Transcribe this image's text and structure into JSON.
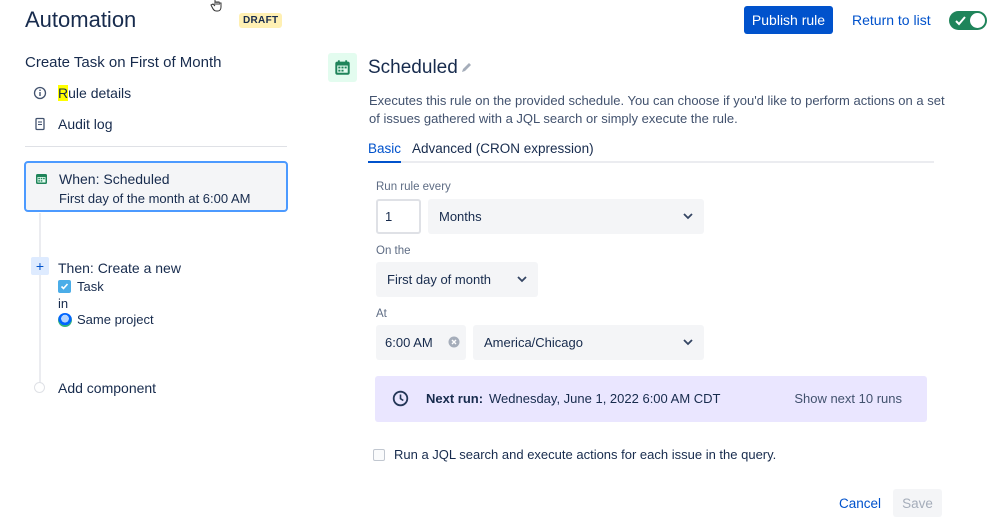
{
  "header": {
    "title": "Automation",
    "badge": "DRAFT",
    "publish_label": "Publish rule",
    "return_label": "Return to list",
    "enabled": true
  },
  "sidebar": {
    "rule_name": "Create Task on First of Month",
    "links": [
      {
        "label_highlight": "R",
        "label_rest": "ule details",
        "icon": "info-icon"
      },
      {
        "label": "Audit log",
        "icon": "document-icon"
      }
    ],
    "trigger": {
      "title": "When: Scheduled",
      "subtitle": "First day of the month at 6:00 AM",
      "icon": "calendar-icon"
    },
    "action": {
      "title": "Then: Create a new",
      "issue_type": "Task",
      "connector": "in",
      "project": "Same project"
    },
    "add_component": "Add component"
  },
  "main": {
    "title": "Scheduled",
    "description": "Executes this rule on the provided schedule. You can choose if you'd like to perform actions on a set of issues gathered with a JQL search or simply execute the rule.",
    "tabs": [
      {
        "label": "Basic",
        "active": true
      },
      {
        "label": "Advanced (CRON expression)",
        "active": false
      }
    ],
    "run_every": {
      "label": "Run rule every",
      "value": "1",
      "unit": "Months"
    },
    "on_the": {
      "label": "On the",
      "value": "First day of month"
    },
    "at": {
      "label": "At",
      "time": "6:00 AM",
      "timezone": "America/Chicago"
    },
    "next_run": {
      "label": "Next run:",
      "value": "Wednesday, June 1, 2022 6:00 AM CDT",
      "show_more": "Show next 10 runs"
    },
    "jql_option": "Run a JQL search and execute actions for each issue in the query.",
    "cancel_label": "Cancel",
    "save_label": "Save"
  },
  "colors": {
    "primary": "#0052cc",
    "toggle_on": "#1f845a",
    "selection_border": "#4c9aff",
    "next_run_bg": "#eae6ff"
  }
}
